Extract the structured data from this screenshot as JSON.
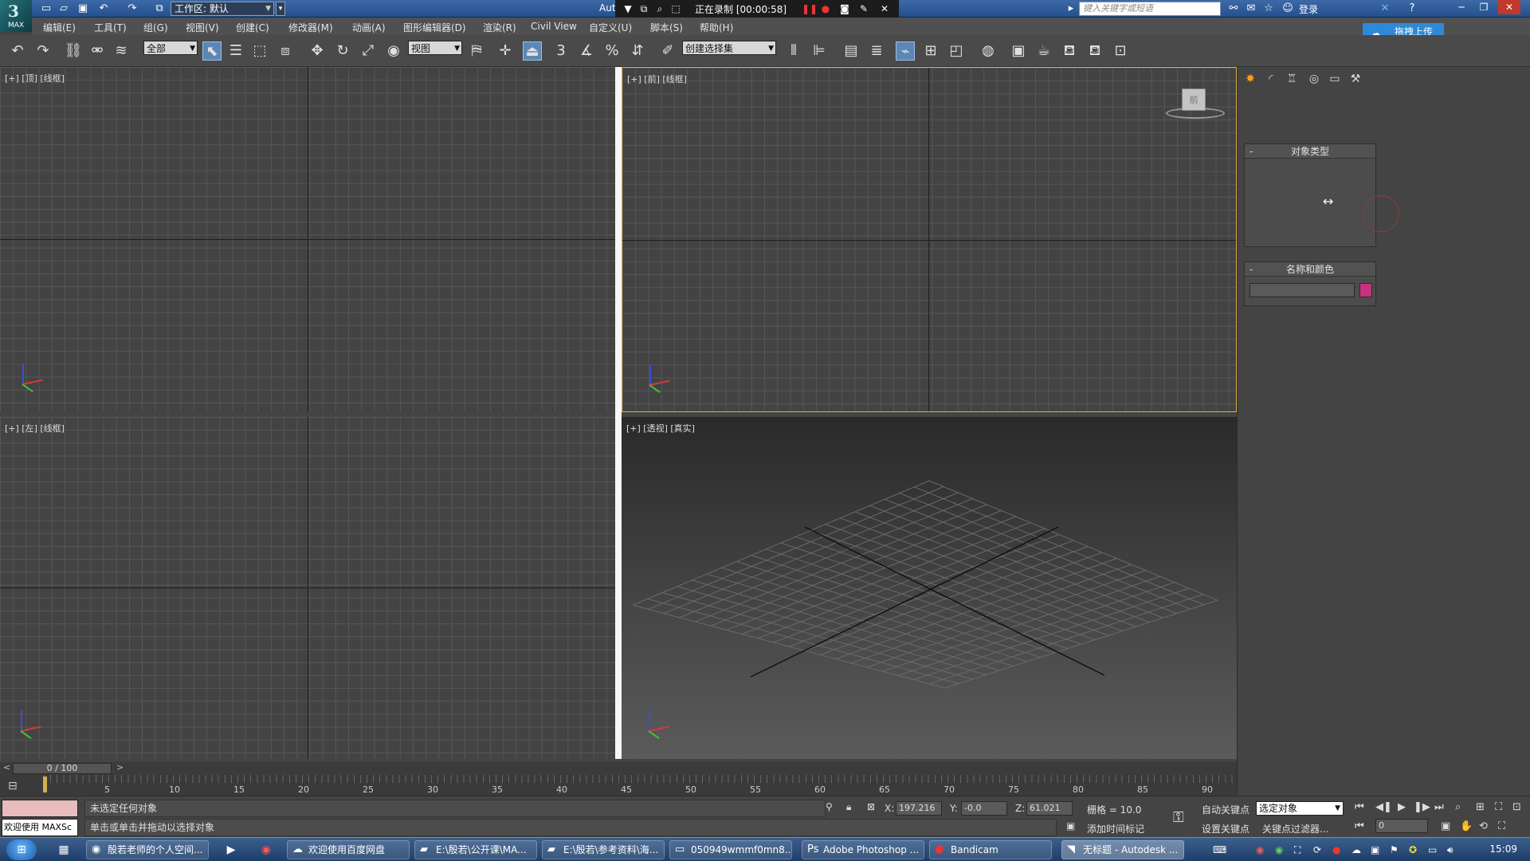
{
  "titlebar": {
    "logo_text": "MAX",
    "workspace_label": "工作区: 默认",
    "app_abbr": "Aut",
    "recording_label": "正在录制 [00:00:58]",
    "search_placeholder": "键入关键字或短语",
    "login_label": "登录"
  },
  "menubar": {
    "items": [
      "编辑(E)",
      "工具(T)",
      "组(G)",
      "视图(V)",
      "创建(C)",
      "修改器(M)",
      "动画(A)",
      "图形编辑器(D)",
      "渲染(R)",
      "Civil View",
      "自定义(U)",
      "脚本(S)",
      "帮助(H)"
    ],
    "upload_label": "拖拽上传"
  },
  "toolbar": {
    "selection_filter": "全部",
    "ref_coord": "视图",
    "snap_labels": [
      "3",
      "%"
    ],
    "named_selection": "创建选择集"
  },
  "viewports": {
    "top_label": "[+] [顶] [线框]",
    "front_label": "[+] [前] [线框]",
    "left_label": "[+] [左] [线框]",
    "persp_label": "[+] [透视] [真实]",
    "viewcube_face": "前"
  },
  "command_panel": {
    "object_type_title": "对象类型",
    "name_color_title": "名称和颜色",
    "name_value": "",
    "color": "#c8317e"
  },
  "timeline": {
    "frame_display": "0 / 100",
    "prev": "<",
    "next": ">",
    "ticks": [
      "5",
      "10",
      "15",
      "20",
      "25",
      "30",
      "35",
      "40",
      "45",
      "50",
      "55",
      "60",
      "65",
      "70",
      "75",
      "80",
      "85",
      "90"
    ]
  },
  "statusbar": {
    "maxscript_label": "欢迎使用 MAXSc",
    "status_top": "未选定任何对象",
    "status_bottom": "单击或单击并拖动以选择对象",
    "x_label": "X:",
    "x_value": "197.216",
    "y_label": "Y:",
    "y_value": "-0.0",
    "z_label": "Z:",
    "z_value": "61.021",
    "grid_label": "栅格 = 10.0",
    "add_time_tag": "添加时间标记",
    "auto_key": "自动关键点",
    "set_key": "设置关键点",
    "selected_dropdown": "选定对象",
    "key_filters": "关键点过滤器...",
    "current_frame": "0"
  },
  "taskbar": {
    "tasks": [
      "殷若老师的个人空间...",
      "欢迎使用百度网盘",
      "E:\\殷若\\公开课\\MA...",
      "E:\\殷若\\参考资料\\海...",
      "050949wmmf0mn8...",
      "Adobe Photoshop ...",
      "Bandicam",
      "无标题 - Autodesk ..."
    ],
    "time": "15:09"
  }
}
